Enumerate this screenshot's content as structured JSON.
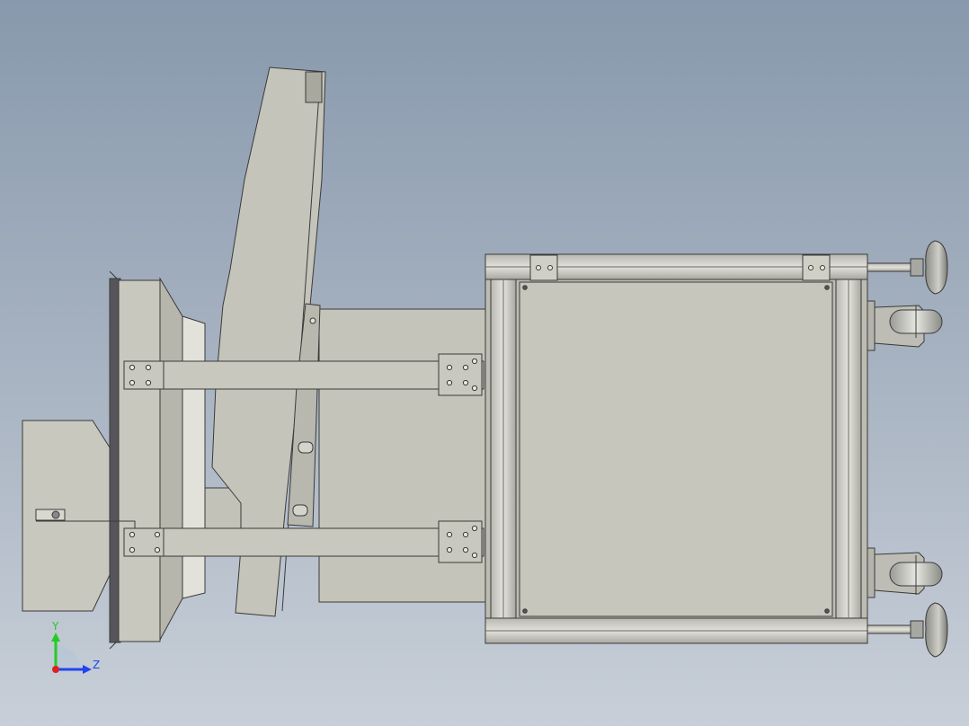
{
  "viewport": {
    "background_top": "#8899ad",
    "background_bottom": "#c8cfd8"
  },
  "colors": {
    "part_fill": "#c8c8be",
    "part_fill_light": "#d4d4cc",
    "part_fill_dark": "#a0a09a",
    "edge": "#3a3a3a",
    "dark_panel": "#55555a"
  },
  "triad": {
    "y_label": "Y",
    "z_label": "Z",
    "y_color": "#22cc22",
    "z_color": "#2244ee",
    "x_color": "#dd2222"
  }
}
